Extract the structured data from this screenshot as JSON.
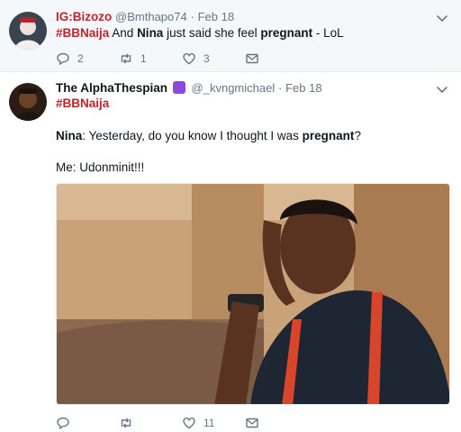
{
  "tweets": [
    {
      "name": "IG:Bizozo",
      "handle": "@Bmthapo74",
      "separator": "·",
      "date": "Feb 18",
      "text_parts": [
        "#BBNaija",
        " And ",
        "Nina",
        " just said she feel ",
        "pregnant",
        " - LoL"
      ],
      "actions": {
        "reply": "2",
        "retweet": "1",
        "like": "3",
        "dm": ""
      }
    },
    {
      "name": "The AlphaThespian",
      "handle": "@_kvngmichael",
      "separator": "·",
      "date": "Feb 18",
      "hashtag": "#BBNaija",
      "quote_parts": [
        "Nina",
        ": Yesterday, do you know I thought I was ",
        "pregnant",
        "?"
      ],
      "reply_line": "Me: Udonminit!!!",
      "actions": {
        "reply": "",
        "retweet": "",
        "like": "11",
        "dm": ""
      }
    }
  ],
  "colors": {
    "accent_red": "#c0232b",
    "muted": "#657786",
    "bg_highlight": "#f5f8fa"
  },
  "icons": [
    "chevron-down-icon",
    "reply-icon",
    "retweet-icon",
    "heart-icon",
    "envelope-icon",
    "verified-style-badge-icon"
  ]
}
